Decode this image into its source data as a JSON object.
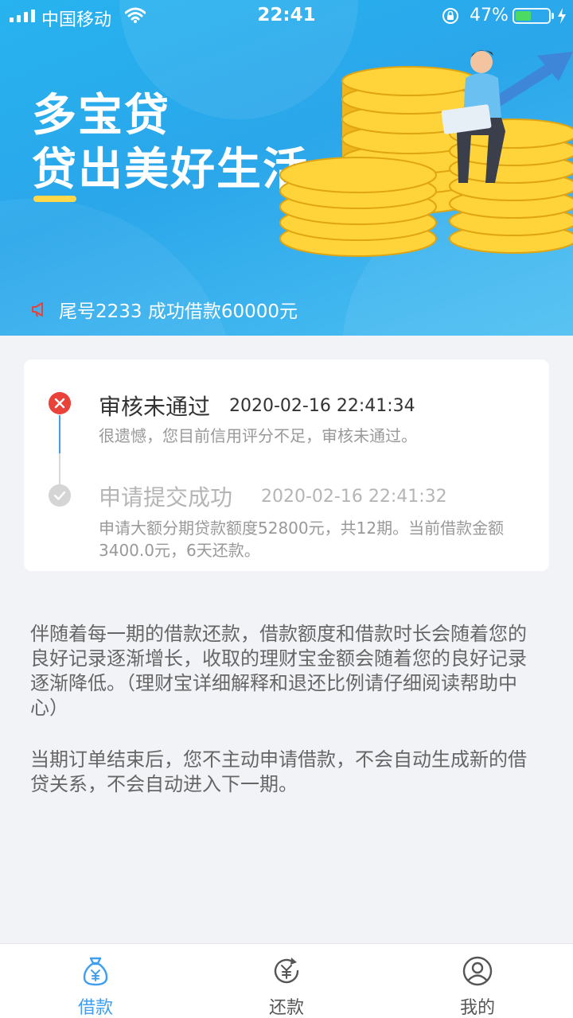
{
  "status_bar": {
    "carrier": "中国移动",
    "time": "22:41",
    "battery_percent": "47%",
    "battery_level": 0.47
  },
  "banner": {
    "brand_name": "多宝贷",
    "slogan": "贷出美好生活",
    "notice": "尾号2233 成功借款60000元"
  },
  "status_card": {
    "steps": [
      {
        "title": "审核未通过",
        "time": "2020-02-16 22:41:34",
        "description": "很遗憾，您目前信用评分不足，审核未通过。",
        "status": "failed"
      },
      {
        "title": "申请提交成功",
        "time": "2020-02-16 22:41:32",
        "description": "申请大额分期贷款额度52800元，共12期。当前借款金额3400.0元，6天还款。",
        "status": "done"
      }
    ]
  },
  "info": {
    "paragraph1": "伴随着每一期的借款还款，借款额度和借款时长会随着您的良好记录逐渐增长，收取的理财宝金额会随着您的良好记录逐渐降低。（理财宝详细解释和退还比例请仔细阅读帮助中心）",
    "paragraph2": "当期订单结束后，您不主动申请借款，不会自动生成新的借贷关系，不会自动进入下一期。"
  },
  "tabbar": {
    "tabs": [
      {
        "label": "借款",
        "icon": "money-bag-icon",
        "active": true
      },
      {
        "label": "还款",
        "icon": "repay-yen-icon",
        "active": false
      },
      {
        "label": "我的",
        "icon": "user-icon",
        "active": false
      }
    ]
  },
  "colors": {
    "accent": "#3f9ef0",
    "fail": "#e8423a",
    "inactive_tab": "#555555"
  }
}
